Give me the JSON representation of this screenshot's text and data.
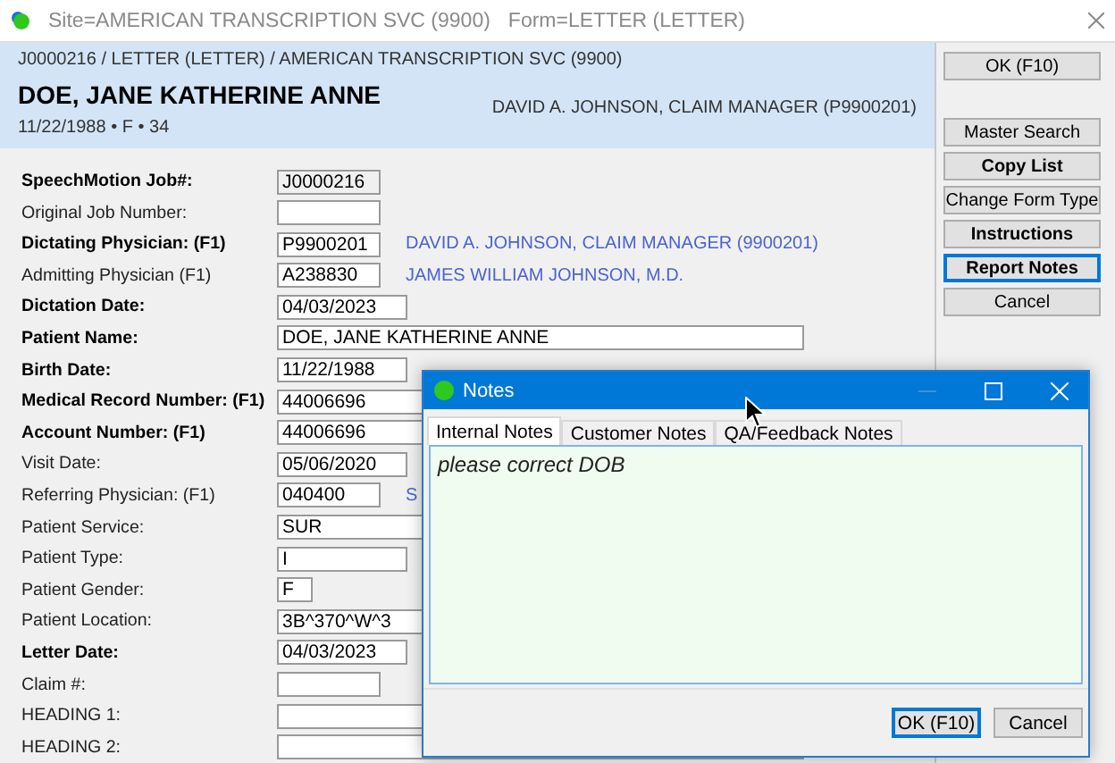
{
  "window": {
    "title_parts": [
      "Site=AMERICAN TRANSCRIPTION SVC (9900)",
      "Form=LETTER (LETTER)"
    ]
  },
  "header": {
    "path": "J0000216 / LETTER (LETTER) / AMERICAN TRANSCRIPTION SVC (9900)",
    "patient": "DOE, JANE KATHERINE ANNE",
    "demographics": "11/22/1988 • F • 34",
    "physician": "DAVID A. JOHNSON, CLAIM MANAGER (P9900201)"
  },
  "form_rows": [
    {
      "label": "SpeechMotion Job#:",
      "required": true,
      "value": "J0000216",
      "readonly": true
    },
    {
      "label": "Original Job Number:",
      "required": false,
      "value": "",
      "readonly": false
    },
    {
      "label": "Dictating Physician: (F1)",
      "required": true,
      "value": "P9900201",
      "readonly": false,
      "link": "DAVID A. JOHNSON, CLAIM MANAGER (9900201)"
    },
    {
      "label": "Admitting Physician (F1)",
      "required": false,
      "value": "A238830",
      "readonly": false,
      "link": "JAMES WILLIAM JOHNSON, M.D."
    },
    {
      "label": "Dictation Date:",
      "required": true,
      "value": "04/03/2023",
      "readonly": false
    },
    {
      "label": "Patient Name:",
      "required": true,
      "value": "DOE, JANE KATHERINE ANNE",
      "readonly": false
    },
    {
      "label": "Birth Date:",
      "required": true,
      "value": "11/22/1988",
      "readonly": false
    },
    {
      "label": "Medical Record Number: (F1)",
      "required": true,
      "value": "44006696",
      "readonly": false
    },
    {
      "label": "Account Number: (F1)",
      "required": true,
      "value": "44006696",
      "readonly": false
    },
    {
      "label": "Visit Date:",
      "required": false,
      "value": "05/06/2020",
      "readonly": false
    },
    {
      "label": "Referring Physician: (F1)",
      "required": false,
      "value": "040400",
      "readonly": false,
      "link": "S"
    },
    {
      "label": "Patient Service:",
      "required": false,
      "value": "SUR",
      "readonly": false
    },
    {
      "label": "Patient Type:",
      "required": false,
      "value": "I",
      "readonly": false
    },
    {
      "label": "Patient Gender:",
      "required": false,
      "value": "F",
      "readonly": false
    },
    {
      "label": "Patient Location:",
      "required": false,
      "value": "3B^370^W^3",
      "readonly": false
    },
    {
      "label": "Letter Date:",
      "required": true,
      "value": "04/03/2023",
      "readonly": false
    },
    {
      "label": "Claim #:",
      "required": false,
      "value": "",
      "readonly": false
    },
    {
      "label": "HEADING 1:",
      "required": false,
      "value": "",
      "readonly": false
    },
    {
      "label": "HEADING 2:",
      "required": false,
      "value": "",
      "readonly": false
    }
  ],
  "side_buttons": [
    {
      "label": "OK  (F10)",
      "bold": false,
      "default": false
    },
    {
      "label": "Master Search",
      "bold": false,
      "default": false
    },
    {
      "label": "Copy List",
      "bold": true,
      "default": false
    },
    {
      "label": "Change Form Type",
      "bold": false,
      "default": false
    },
    {
      "label": "Instructions",
      "bold": true,
      "default": false
    },
    {
      "label": "Report Notes",
      "bold": true,
      "default": true
    },
    {
      "label": "Cancel",
      "bold": false,
      "default": false
    }
  ],
  "notes_dialog": {
    "title": "Notes",
    "tabs": [
      {
        "label": "Internal Notes",
        "selected": true
      },
      {
        "label": "Customer Notes",
        "selected": false
      },
      {
        "label": "QA/Feedback Notes",
        "selected": false
      }
    ],
    "text": "please correct DOB",
    "minimize_disabled": true,
    "buttons": [
      {
        "label": "OK (F10)",
        "default": true
      },
      {
        "label": "Cancel",
        "default": false
      }
    ]
  }
}
